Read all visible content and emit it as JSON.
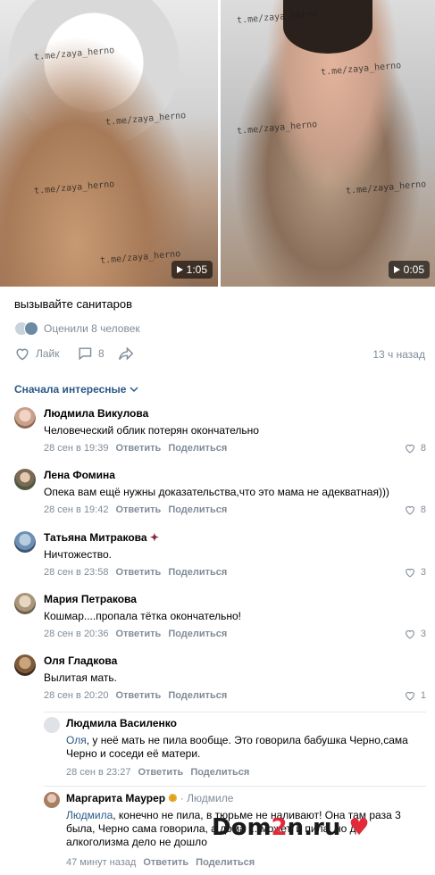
{
  "videos": [
    {
      "duration": "1:05",
      "watermark": "t.me/zaya_herno"
    },
    {
      "duration": "0:05",
      "watermark": "t.me/zaya_herno"
    }
  ],
  "post": {
    "caption": "вызывайте санитаров",
    "rated": "Оценили 8 человек",
    "like_label": "Лайк",
    "comments_count": "8",
    "time": "13 ч назад"
  },
  "sort_label": "Сначала интересные",
  "comments": [
    {
      "name": "Людмила Викулова",
      "text": "Человеческий облик потерян окончательно",
      "date": "28 сен в 19:39",
      "reply": "Ответить",
      "share": "Поделиться",
      "likes": "8"
    },
    {
      "name": "Лена Фомина",
      "text": "Опека вам ещё нужны доказательства,что это мама не адекватная)))",
      "date": "28 сен в 19:42",
      "reply": "Ответить",
      "share": "Поделиться",
      "likes": "8"
    },
    {
      "name": "Татьяна Митракова",
      "text": "Ничтожество.",
      "date": "28 сен в 23:58",
      "reply": "Ответить",
      "share": "Поделиться",
      "likes": "3"
    },
    {
      "name": "Мария Петракова",
      "text": "Кошмар....пропала тётка окончательно!",
      "date": "28 сен в 20:36",
      "reply": "Ответить",
      "share": "Поделиться",
      "likes": "3"
    },
    {
      "name": "Оля Гладкова",
      "text": "Вылитая мать.",
      "date": "28 сен в 20:20",
      "reply": "Ответить",
      "share": "Поделиться",
      "likes": "1"
    }
  ],
  "replies": [
    {
      "name": "Людмила Василенко",
      "mention": "Оля",
      "text": ", у неё мать не пила вообще. Это говорила бабушка Черно,сама Черно и соседи её матери.",
      "date": "28 сен в 23:27",
      "reply": "Ответить",
      "share": "Поделиться"
    },
    {
      "name": "Маргарита Маурер",
      "to": "Людмиле",
      "mention": "Людмила",
      "text": ", конечно не пила, в тюрьме не наливают! Она там раза 3 была, Черно сама говорила, а дома ... может, и пила, но до алкоголизма дело не дошло",
      "date": "47 минут назад",
      "reply": "Ответить",
      "share": "Поделиться"
    }
  ],
  "logo": {
    "part1": "Dom",
    "part2": "2",
    "part3": "n.ru"
  },
  "colors": {
    "link": "#2a5885",
    "meta": "#818c99",
    "divider": "#e7e8ec"
  }
}
